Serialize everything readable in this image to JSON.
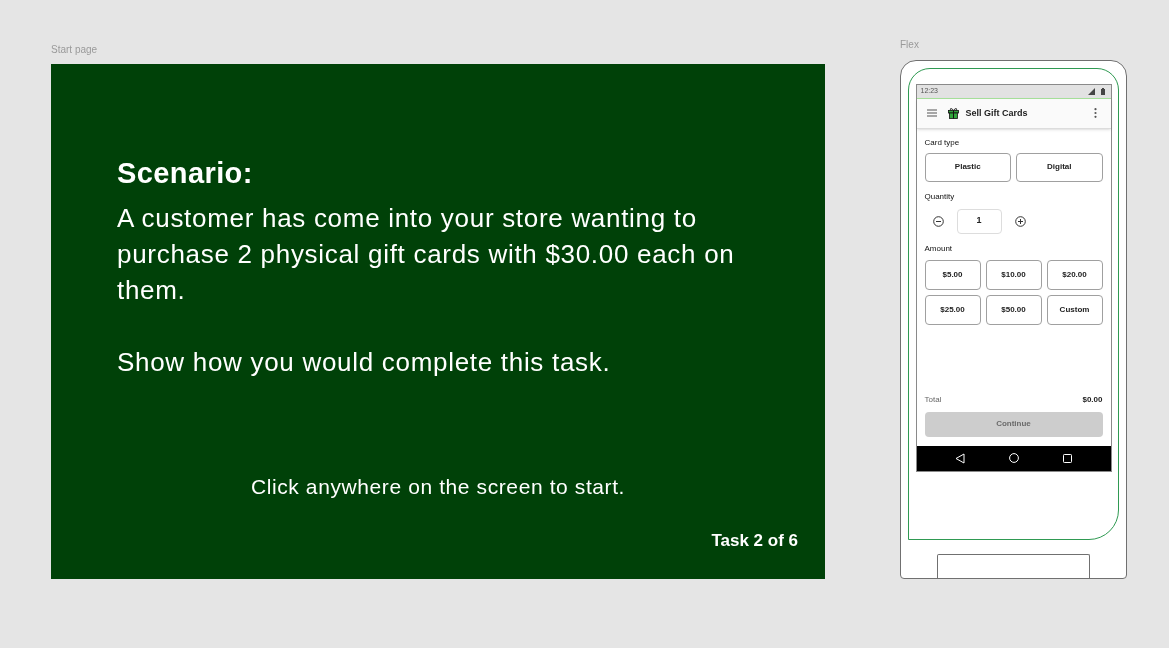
{
  "start_page": {
    "label": "Start page",
    "heading": "Scenario:",
    "paragraphs": [
      "A customer has come into your store wanting to purchase 2 physical gift cards with $30.00 each on them.",
      "Show how you would complete this task."
    ],
    "instruction": "Click anywhere on the screen to start.",
    "task_counter": "Task 2 of 6"
  },
  "flex": {
    "label": "Flex",
    "status_bar": {
      "time": "12:23"
    },
    "app_bar": {
      "title": "Sell Gift Cards"
    },
    "card_type": {
      "label": "Card type",
      "options": [
        {
          "label": "Plastic",
          "selected": false
        },
        {
          "label": "Digital",
          "selected": false
        }
      ]
    },
    "quantity": {
      "label": "Quantity",
      "value": "1"
    },
    "amount": {
      "label": "Amount",
      "options": [
        {
          "label": "$5.00",
          "selected": false
        },
        {
          "label": "$10.00",
          "selected": false
        },
        {
          "label": "$20.00",
          "selected": false
        },
        {
          "label": "$25.00",
          "selected": false
        },
        {
          "label": "$50.00",
          "selected": false
        },
        {
          "label": "Custom",
          "selected": false
        }
      ]
    },
    "total": {
      "label": "Total",
      "value": "$0.00"
    },
    "continue_button": {
      "label": "Continue",
      "disabled": true
    }
  }
}
